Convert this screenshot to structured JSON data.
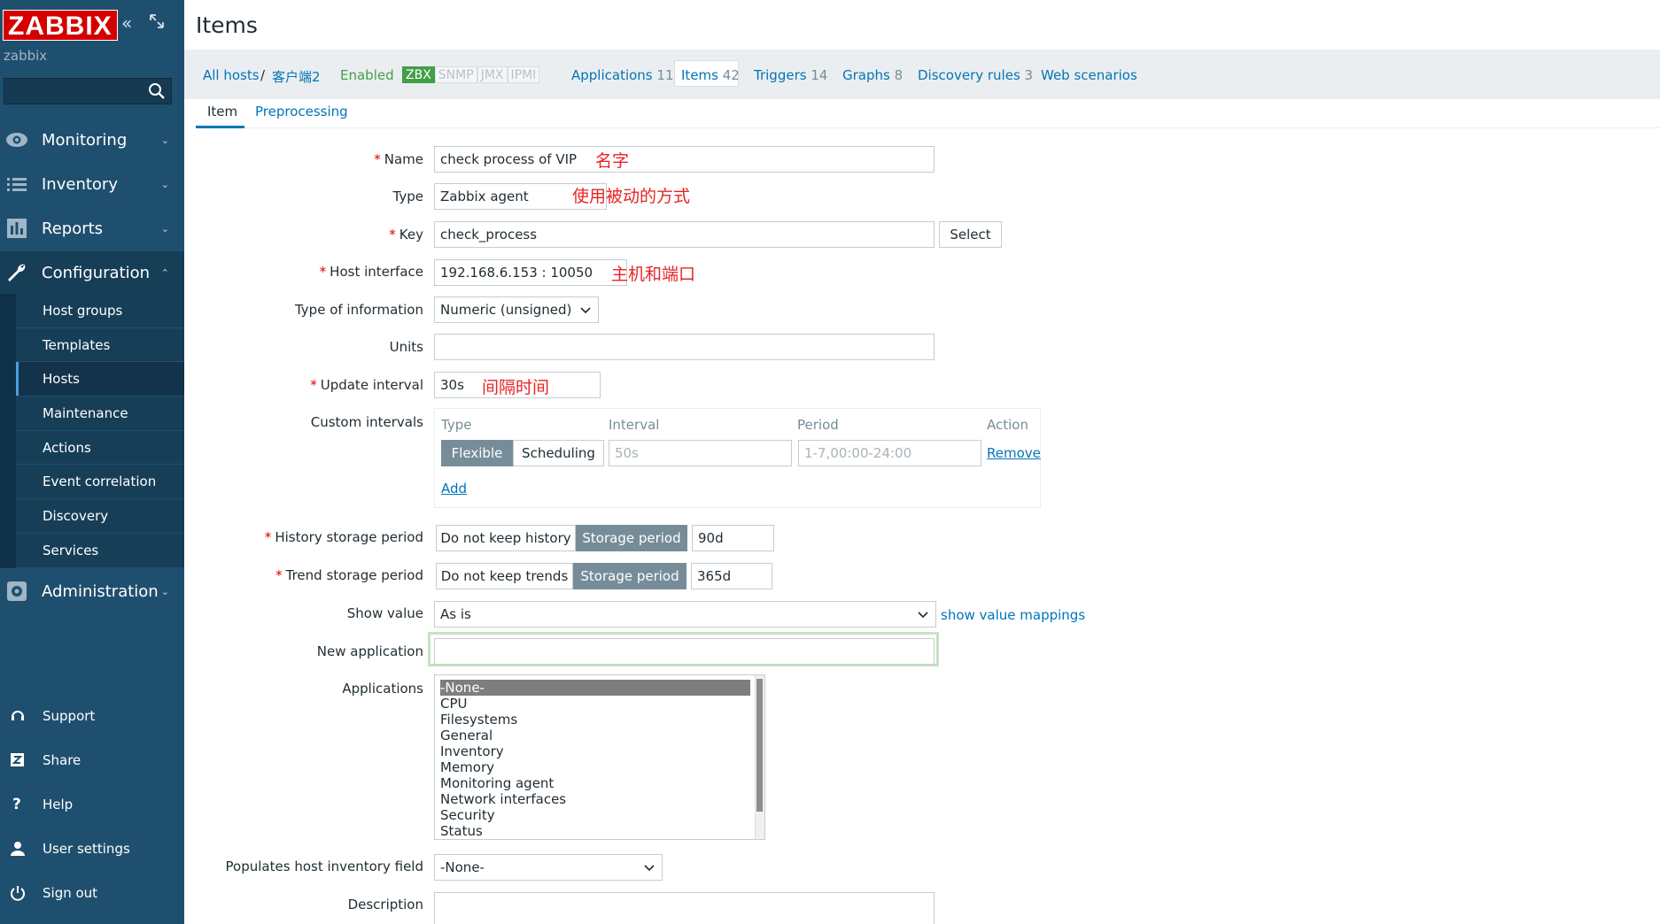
{
  "sidebar": {
    "logo": "ZABBIX",
    "server_name": "zabbix",
    "menu": [
      {
        "label": "Monitoring"
      },
      {
        "label": "Inventory"
      },
      {
        "label": "Reports"
      },
      {
        "label": "Configuration"
      },
      {
        "label": "Administration"
      }
    ],
    "config_items": [
      "Host groups",
      "Templates",
      "Hosts",
      "Maintenance",
      "Actions",
      "Event correlation",
      "Discovery",
      "Services"
    ],
    "bottom": [
      "Support",
      "Share",
      "Help",
      "User settings",
      "Sign out"
    ]
  },
  "page": {
    "title": "Items"
  },
  "hostbar": {
    "all_hosts": "All hosts",
    "separator": "/",
    "host": "客户端2",
    "enabled": "Enabled",
    "statuses": [
      "ZBX",
      "SNMP",
      "JMX",
      "IPMI"
    ],
    "applications": "Applications",
    "applications_count": "11",
    "items": "Items",
    "items_count": "42",
    "triggers": "Triggers",
    "triggers_count": "14",
    "graphs": "Graphs",
    "graphs_count": "8",
    "discovery": "Discovery rules",
    "discovery_count": "3",
    "web": "Web scenarios"
  },
  "tabs": {
    "item": "Item",
    "preprocessing": "Preprocessing"
  },
  "form": {
    "name_label": "Name",
    "name_value": "check process of VIP",
    "type_label": "Type",
    "type_value": "Zabbix agent",
    "key_label": "Key",
    "key_value": "check_process",
    "select_btn": "Select",
    "host_interface_label": "Host interface",
    "host_interface_value": "192.168.6.153 : 10050",
    "type_info_label": "Type of information",
    "type_info_value": "Numeric (unsigned)",
    "units_label": "Units",
    "units_value": "",
    "update_label": "Update interval",
    "update_value": "30s",
    "custom_label": "Custom intervals",
    "ci_head_type": "Type",
    "ci_head_interval": "Interval",
    "ci_head_period": "Period",
    "ci_head_action": "Action",
    "ci_flexible": "Flexible",
    "ci_scheduling": "Scheduling",
    "ci_interval_placeholder": "50s",
    "ci_period_placeholder": "1-7,00:00-24:00",
    "ci_remove": "Remove",
    "ci_add": "Add",
    "history_label": "History storage period",
    "history_no": "Do not keep history",
    "history_storage": "Storage period",
    "history_value": "90d",
    "trend_label": "Trend storage period",
    "trend_no": "Do not keep trends",
    "trend_storage": "Storage period",
    "trend_value": "365d",
    "show_value_label": "Show value",
    "show_value_value": "As is",
    "show_value_link": "show value mappings",
    "new_app_label": "New application",
    "new_app_value": "",
    "applications_label": "Applications",
    "applications_list": [
      "-None-",
      "CPU",
      "Filesystems",
      "General",
      "Inventory",
      "Memory",
      "Monitoring agent",
      "Network interfaces",
      "Security",
      "Status"
    ],
    "inventory_label": "Populates host inventory field",
    "inventory_value": "-None-",
    "description_label": "Description"
  },
  "annotations": {
    "name": "名字",
    "type": "使用被动的方式",
    "host_interface": "主机和端口",
    "update": "间隔时间"
  }
}
